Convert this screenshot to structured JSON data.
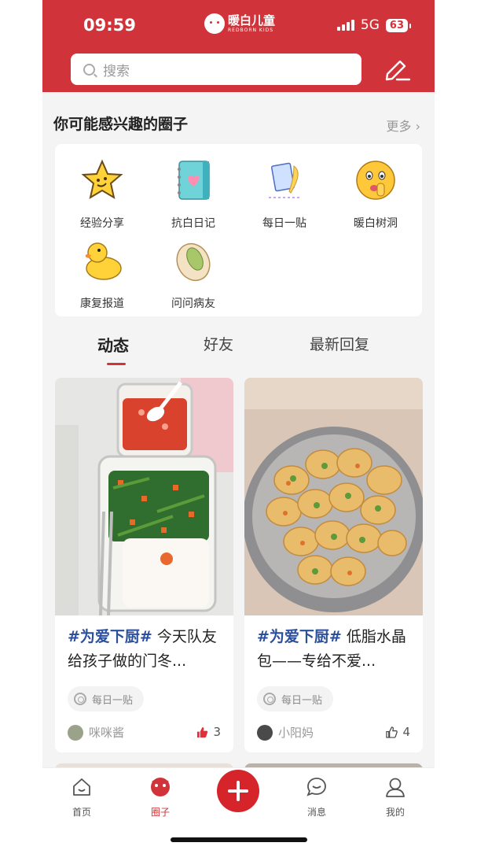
{
  "status_bar": {
    "time": "09:59",
    "network": "5G",
    "battery": "63"
  },
  "brand": {
    "name_cn": "暖白儿童",
    "name_en": "REDBORN KIDS"
  },
  "search": {
    "placeholder": "搜索"
  },
  "circles": {
    "title": "你可能感兴趣的圈子",
    "more": "更多",
    "items": [
      {
        "label": "经验分享",
        "icon": "star-face-icon"
      },
      {
        "label": "抗白日记",
        "icon": "notebook-heart-icon"
      },
      {
        "label": "每日一贴",
        "icon": "paper-feather-icon"
      },
      {
        "label": "暖白树洞",
        "icon": "shush-emoji-icon"
      },
      {
        "label": "康复报道",
        "icon": "duck-icon"
      },
      {
        "label": "问问病友",
        "icon": "pistachio-icon"
      }
    ]
  },
  "tabs": [
    {
      "label": "动态",
      "active": true
    },
    {
      "label": "好友",
      "active": false
    },
    {
      "label": "最新回复",
      "active": false
    }
  ],
  "posts": [
    {
      "tag": "#为爱下厨#",
      "text": " 今天队友给孩子做的门冬...",
      "circle": "每日一贴",
      "author": "咪咪酱",
      "likes": "3",
      "liked": true,
      "image": "meal-box-photo"
    },
    {
      "tag": "#为爱下厨#",
      "text": " 低脂水晶包——专给不爱...",
      "circle": "每日一贴",
      "author": "小阳妈",
      "likes": "4",
      "liked": false,
      "image": "dumplings-photo"
    }
  ],
  "bottom_nav": [
    {
      "label": "首页",
      "icon": "home-icon",
      "active": false
    },
    {
      "label": "圈子",
      "icon": "circle-icon",
      "active": true
    },
    {
      "label": "",
      "icon": "plus-icon",
      "active": false
    },
    {
      "label": "消息",
      "icon": "message-icon",
      "active": false
    },
    {
      "label": "我的",
      "icon": "profile-icon",
      "active": false
    }
  ],
  "colors": {
    "brand_red": "#d0343a",
    "tag_blue": "#2b4f9c",
    "like_red": "#e0303a"
  }
}
